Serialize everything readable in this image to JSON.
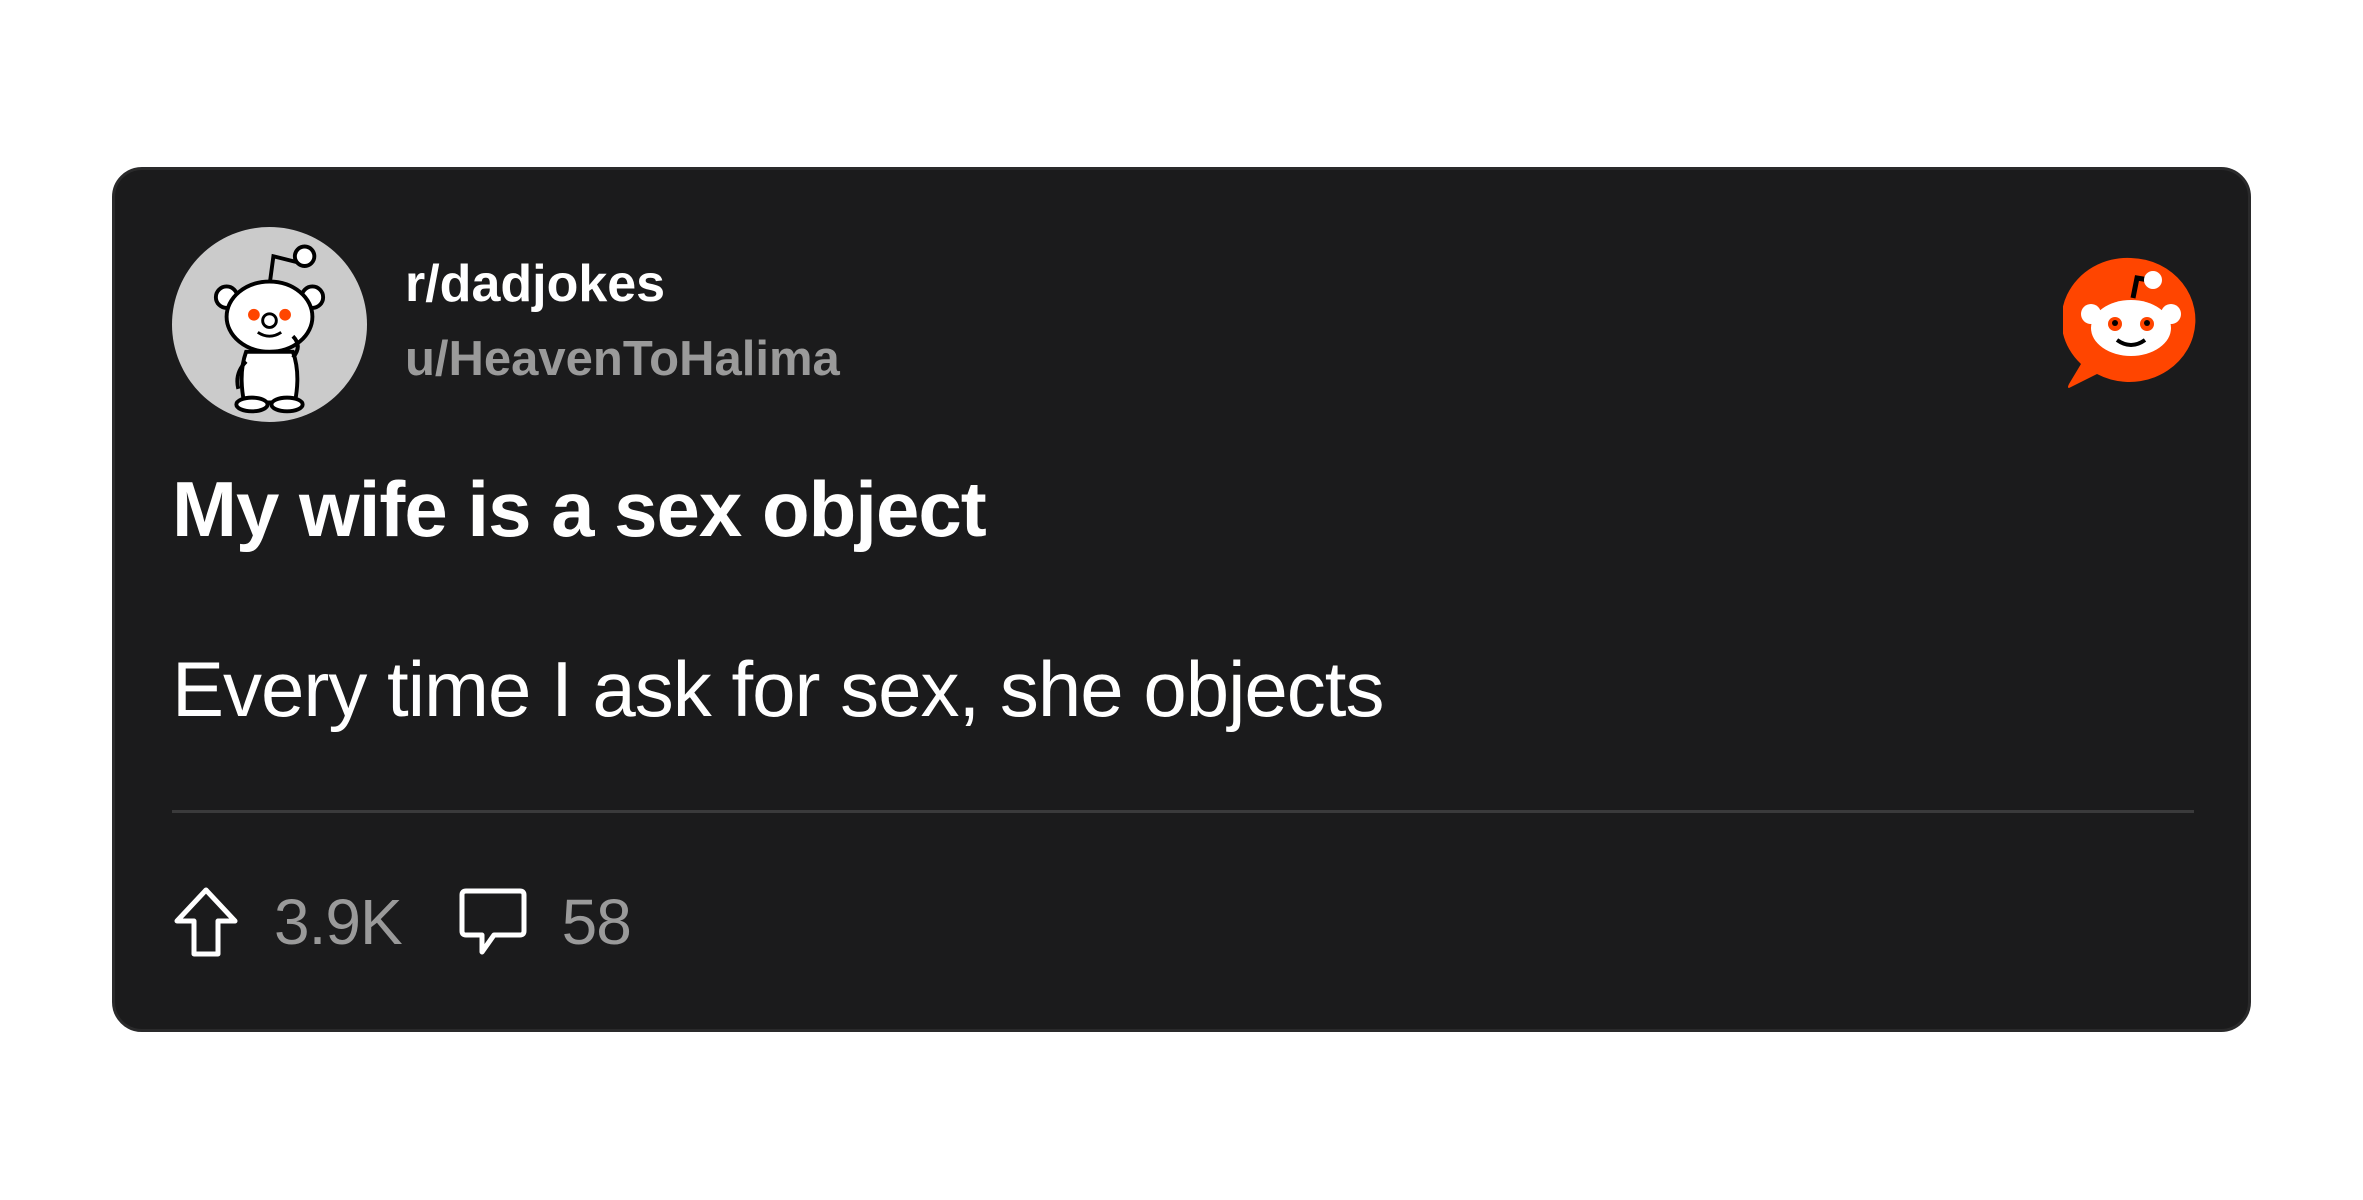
{
  "post": {
    "subreddit": "r/dadjokes",
    "username": "u/HeavenToHalima",
    "title": "My wife is a sex object",
    "body": "Every time I ask for sex, she objects",
    "upvotes": "3.9K",
    "comments": "58"
  },
  "icons": {
    "avatar": "snoo-avatar-icon",
    "logo": "reddit-logo-icon",
    "upvote": "upvote-arrow-icon",
    "comment": "comment-bubble-icon"
  },
  "colors": {
    "card_background": "#1b1b1c",
    "reddit_orange": "#ff4500",
    "muted_text": "#9a9a9a",
    "avatar_background": "#cbcbcb"
  }
}
